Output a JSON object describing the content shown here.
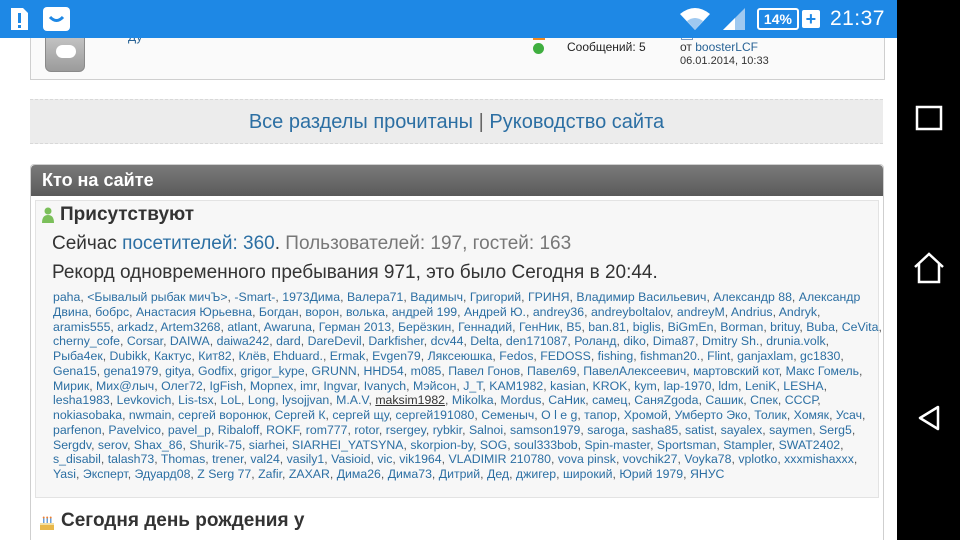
{
  "status_bar": {
    "battery_percent": "14%",
    "battery_plus": "+",
    "time": "21:37",
    "icons": [
      "sd-card-warning-icon",
      "chat-app-icon",
      "wifi-icon",
      "signal-icon",
      "battery-icon"
    ]
  },
  "nav_bar": {
    "buttons": [
      "recent-apps-icon",
      "home-icon",
      "back-icon"
    ]
  },
  "forum_fragment": {
    "title_fragment": "Ду",
    "messages": "Сообщений: 5",
    "author_prefix": "от",
    "author": "boosterLCF",
    "date": "06.01.2014, 10:33"
  },
  "links": {
    "all_read": "Все разделы прочитаны",
    "separator": "|",
    "guide": "Руководство сайта"
  },
  "who_online": {
    "header": "Кто на сайте",
    "present_title": "Присутствуют",
    "now_prefix": "Сейчас",
    "visitors_link": "посетителей: 360",
    "dot": ".",
    "users_guests": "Пользователей: 197, гостей: 163",
    "record": "Рекорд одновременного пребывания 971, это было Сегодня в 20:44.",
    "users": [
      "paha",
      "<Бывалый рыбак мичЪ>",
      "-Smart-",
      "1973Дима",
      "Валера71",
      "Вадимыч",
      "Григорий",
      "ГРИНЯ",
      "Владимир Васильевич",
      "Александр 88",
      "Александр Двина",
      "бобрс",
      "Анастасия Юрьевна",
      "Богдан",
      "ворон",
      "волька",
      "андрей 199",
      "Андрей Ю.",
      "andrey36",
      "andreyboltalov",
      "andreyM",
      "Andrius",
      "Andryk",
      "aramis555",
      "arkadz",
      "Artem3268",
      "atlant",
      "Awaruna",
      "Герман 2013",
      "Берёзкин",
      "Геннадий",
      "ГенНик",
      "B5",
      "ban.81",
      "biglis",
      "BiGmEn",
      "Borman",
      "brituy",
      "Buba",
      "CeVita",
      "cherny_cofe",
      "Corsar",
      "DAIWA",
      "daiwa242",
      "dard",
      "DareDevil",
      "Darkfisher",
      "dcv44",
      "Delta",
      "den171087",
      "Роланд",
      "diko",
      "Dima87",
      "Dmitry Sh.",
      "drunia.volk",
      "Рыба4ек",
      "Dubikk",
      "Кактус",
      "Кит82",
      "Клёв",
      "Ehduard.",
      "Ermak",
      "Evgen79",
      "Ляксеюшка",
      "Fedos",
      "FEDOSS",
      "fishing",
      "fishman20.",
      "Flint",
      "ganjaxlam",
      "gc1830",
      "Gena15",
      "gena1979",
      "gitya",
      "Godfix",
      "grigor_kype",
      "GRUNN",
      "HHD54",
      "m085",
      "Павел Гонов",
      "Павел69",
      "ПавелАлексеевич",
      "мартовский кот",
      "Макс Гомель",
      "Мирик",
      "Мих@лыч",
      "Олег72",
      "IgFish",
      "Морпех",
      "imr",
      "Ingvar",
      "Ivanych",
      "Мэйсон",
      "J_T",
      "KAM1982",
      "kasian",
      "KROK",
      "kym",
      "lap-1970",
      "ldm",
      "LeniK",
      "LESHA",
      "lesha1983",
      "Levkovich",
      "Lis-tsx",
      "LoL",
      "Long",
      "lysojjvan",
      "M.A.V",
      "maksim1982",
      "Mikolka",
      "Mordus",
      "СаНик",
      "самец",
      "СаняZgoda",
      "Сашик",
      "Спек",
      "СССР",
      "nokiasobaka",
      "nwmain",
      "сергей воронюк",
      "Сергей К",
      "сергей щу",
      "сергей191080",
      "Семеныч",
      "О l e g",
      "тапор",
      "Хромой",
      "Умберто Эко",
      "Толик",
      "Хомяк",
      "Усач",
      "parfenon",
      "Pavelvico",
      "pavel_p",
      "Ribaloff",
      "ROKF",
      "rom777",
      "rotor",
      "rsergey",
      "rybkir",
      "Salnoi",
      "samson1979",
      "saroga",
      "sasha85",
      "satist",
      "sayalex",
      "saymen",
      "Serg5",
      "Sergdv",
      "serov",
      "Shax_86",
      "Shurik-75",
      "siarhei",
      "SIARHEI_YATSYNA",
      "skorpion-by",
      "SOG",
      "soul333bob",
      "Spin-master",
      "Sportsman",
      "Stampler",
      "SWAT2402",
      "s_disabil",
      "talash73",
      "Thomas",
      "trener",
      "val24",
      "vasily1",
      "Vasioid",
      "vic",
      "vik1964",
      "VLADIMIR 210780",
      "vova pinsk",
      "vovchik27",
      "Voyka78",
      "vplotko",
      "xxxmishaxxx",
      "Yasi",
      "Эксперт",
      "Эдуард08",
      "Z Serg 77",
      "Zafir",
      "ZAXAR",
      "Дима26",
      "Дима73",
      "Дитрий",
      "Дед",
      "джигер",
      "широкий",
      "Юрий 1979",
      "ЯНУС"
    ],
    "users_highlighted": [
      "maksim1982"
    ],
    "birthday_title": "Сегодня день рождения у"
  }
}
